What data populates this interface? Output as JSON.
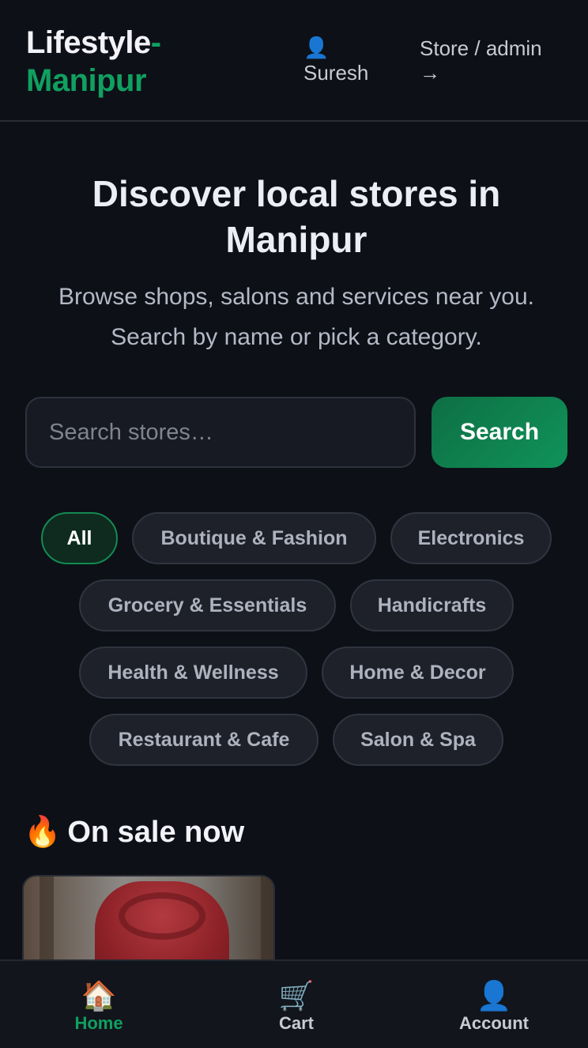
{
  "header": {
    "brand_part1": "Lifestyle",
    "brand_dash": "-",
    "brand_part2": "Manipur",
    "user_icon": "👤",
    "user_name": "Suresh",
    "admin_label": "Store / admin",
    "admin_arrow": "→"
  },
  "hero": {
    "title": "Discover local stores in Manipur",
    "subtitle": "Browse shops, salons and services near you. Search by name or pick a category."
  },
  "search": {
    "placeholder": "Search stores…",
    "value": "",
    "button_label": "Search"
  },
  "categories": [
    {
      "label": "All",
      "active": true
    },
    {
      "label": "Boutique & Fashion",
      "active": false
    },
    {
      "label": "Electronics",
      "active": false
    },
    {
      "label": "Grocery & Essentials",
      "active": false
    },
    {
      "label": "Handicrafts",
      "active": false
    },
    {
      "label": "Health & Wellness",
      "active": false
    },
    {
      "label": "Home & Decor",
      "active": false
    },
    {
      "label": "Restaurant & Cafe",
      "active": false
    },
    {
      "label": "Salon & Spa",
      "active": false
    }
  ],
  "sale": {
    "icon": "🔥",
    "heading": "On sale now"
  },
  "bottom_nav": [
    {
      "icon": "🏠",
      "label": "Home",
      "active": true
    },
    {
      "icon": "🛒",
      "label": "Cart",
      "active": false
    },
    {
      "icon": "👤",
      "label": "Account",
      "active": false
    }
  ],
  "colors": {
    "background": "#0d1017",
    "accent": "#10a060",
    "chip_bg": "#1e212a"
  }
}
